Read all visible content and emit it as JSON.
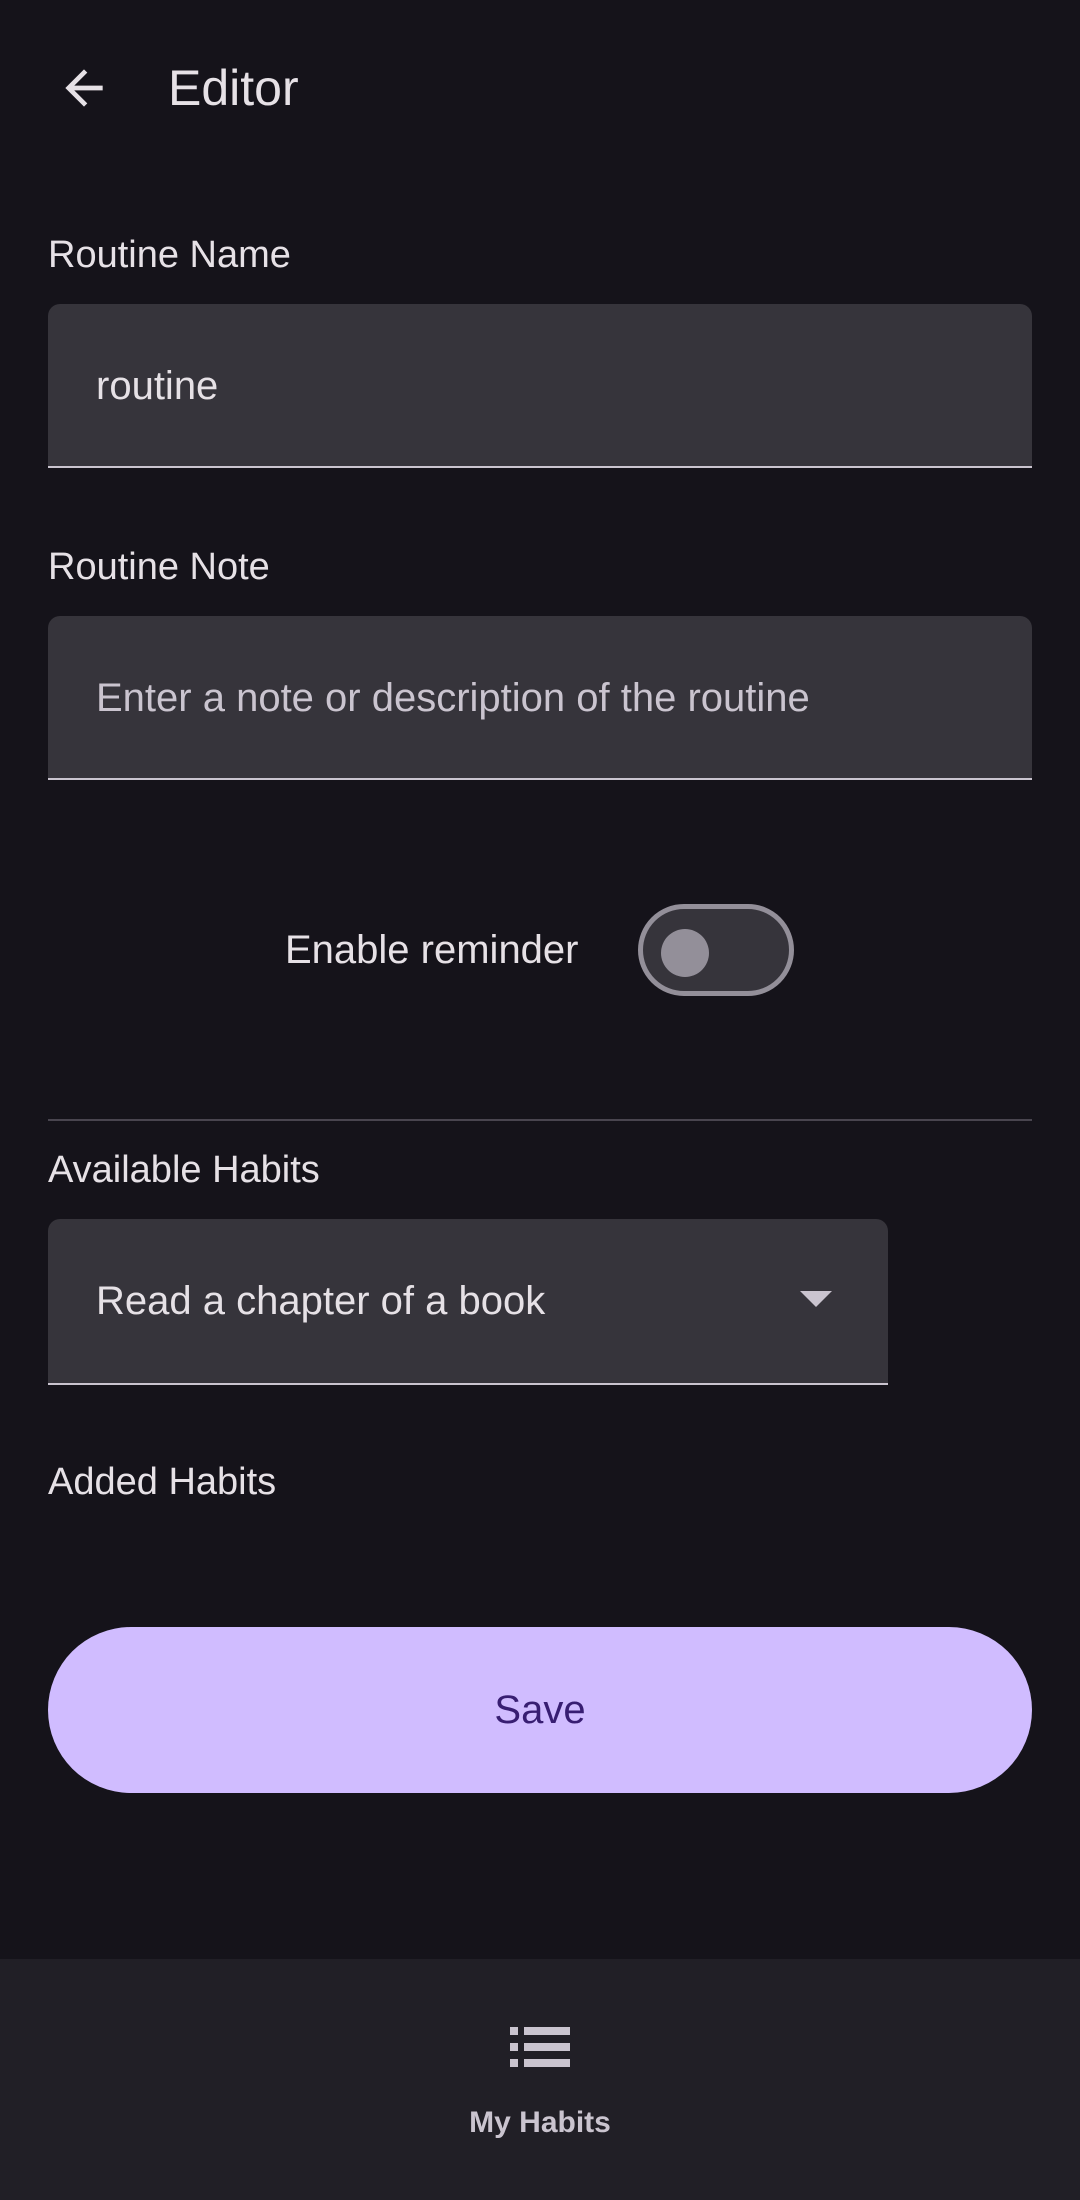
{
  "app_bar": {
    "back_icon": "arrow-back-icon",
    "title": "Editor"
  },
  "form": {
    "routine_name": {
      "label": "Routine Name",
      "value": "routine"
    },
    "routine_note": {
      "label": "Routine Note",
      "value": "",
      "placeholder": "Enter a note or description of the routine"
    },
    "reminder": {
      "label": "Enable reminder",
      "enabled": false
    },
    "available_habits": {
      "label": "Available Habits",
      "selected": "Read a chapter of a book",
      "arrow_icon": "dropdown-arrow-icon"
    },
    "added_habits": {
      "label": "Added Habits",
      "items": []
    },
    "save_label": "Save"
  },
  "bottom_nav": {
    "items": [
      {
        "label": "My Habits",
        "icon": "list-icon"
      }
    ]
  },
  "colors": {
    "background": "#15131a",
    "field_background": "#36343b",
    "primary_container": "#d0bcff",
    "on_primary_container": "#381e72",
    "nav_background": "#211f26"
  }
}
